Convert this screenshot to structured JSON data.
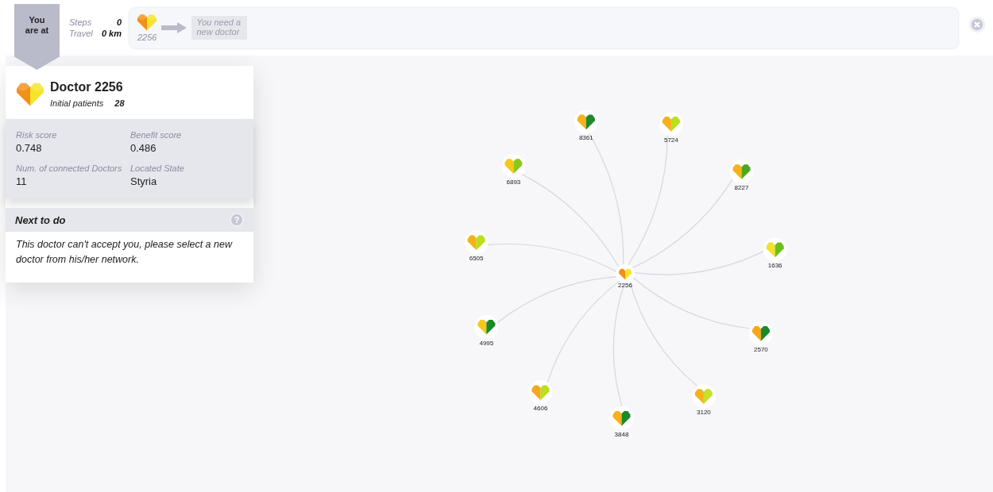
{
  "location_tag": "You are at",
  "stats": [
    {
      "label": "Steps",
      "value": "0"
    },
    {
      "label": "Travel",
      "value": "0 km"
    }
  ],
  "path": {
    "start": {
      "id": "2256",
      "halves": [
        {
          "color": "#f39019"
        },
        {
          "color": "#f5e52a"
        }
      ]
    },
    "message": "You need a new doctor"
  },
  "doctor": {
    "title": "Doctor 2256",
    "halves": [
      {
        "color": "#f39019"
      },
      {
        "color": "#f5e52a"
      }
    ],
    "patients_label": "Initial patients",
    "patients_value": "28",
    "fields": [
      {
        "label": "Risk score",
        "value": "0.748"
      },
      {
        "label": "Benefit score",
        "value": "0.486"
      },
      {
        "label": "Num. of connected Doctors",
        "value": "11"
      },
      {
        "label": "Located State",
        "value": "Styria"
      }
    ]
  },
  "next": {
    "title": "Next to do",
    "help": "?",
    "text": "This doctor can't accept you, please select a new doctor from his/her network."
  },
  "network": {
    "center": {
      "id": "2256",
      "halves": [
        {
          "color": "#f39019"
        },
        {
          "color": "#f5e52a"
        }
      ]
    },
    "nodes": [
      {
        "id": "8361",
        "halves": [
          {
            "color": "#f6b21a"
          },
          {
            "color": "#1a8a2a"
          }
        ]
      },
      {
        "id": "5724",
        "halves": [
          {
            "color": "#f6b21a"
          },
          {
            "color": "#b8e01c"
          }
        ]
      },
      {
        "id": "8227",
        "halves": [
          {
            "color": "#f6b21a"
          },
          {
            "color": "#4aa81a"
          }
        ]
      },
      {
        "id": "1636",
        "halves": [
          {
            "color": "#f3e12a"
          },
          {
            "color": "#6cbf1c"
          }
        ]
      },
      {
        "id": "2570",
        "halves": [
          {
            "color": "#f6a81a"
          },
          {
            "color": "#1a8a2a"
          }
        ]
      },
      {
        "id": "3120",
        "halves": [
          {
            "color": "#f6b21a"
          },
          {
            "color": "#c8e02a"
          }
        ]
      },
      {
        "id": "3848",
        "halves": [
          {
            "color": "#f6b21a"
          },
          {
            "color": "#1a8a2a"
          }
        ]
      },
      {
        "id": "4606",
        "halves": [
          {
            "color": "#f6a81a"
          },
          {
            "color": "#b8e01c"
          }
        ]
      },
      {
        "id": "4995",
        "halves": [
          {
            "color": "#f6c81a"
          },
          {
            "color": "#1a8a2a"
          }
        ]
      },
      {
        "id": "6505",
        "halves": [
          {
            "color": "#f6b21a"
          },
          {
            "color": "#b8e01c"
          }
        ]
      },
      {
        "id": "6893",
        "halves": [
          {
            "color": "#f6c81a"
          },
          {
            "color": "#8cc81c"
          }
        ]
      }
    ]
  }
}
